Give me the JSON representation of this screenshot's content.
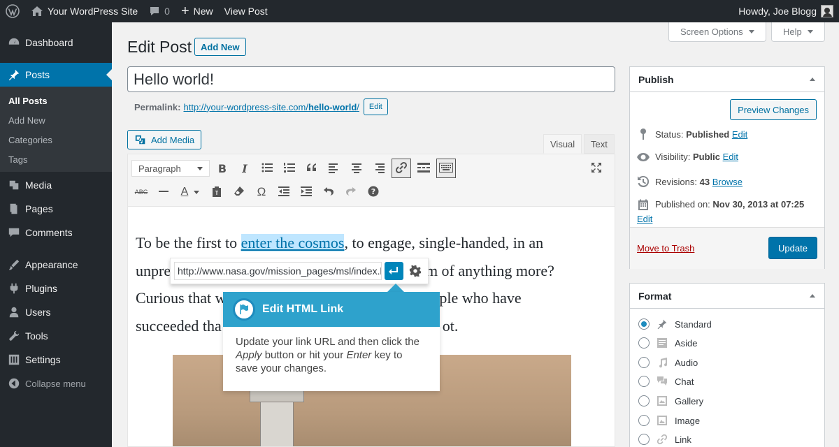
{
  "admin_bar": {
    "site_name": "Your WordPress Site",
    "comments_count": "0",
    "new_label": "New",
    "view_post": "View Post",
    "greeting": "Howdy, Joe Blogg"
  },
  "sidebar": {
    "items": [
      {
        "label": "Dashboard",
        "icon": "dashboard-icon"
      },
      {
        "label": "Posts",
        "icon": "pin-icon"
      },
      {
        "label": "Media",
        "icon": "media-icon"
      },
      {
        "label": "Pages",
        "icon": "pages-icon"
      },
      {
        "label": "Comments",
        "icon": "comments-icon"
      },
      {
        "label": "Appearance",
        "icon": "appearance-icon"
      },
      {
        "label": "Plugins",
        "icon": "plugins-icon"
      },
      {
        "label": "Users",
        "icon": "users-icon"
      },
      {
        "label": "Tools",
        "icon": "tools-icon"
      },
      {
        "label": "Settings",
        "icon": "settings-icon"
      },
      {
        "label": "Collapse menu",
        "icon": "collapse-icon"
      }
    ],
    "submenu": [
      "All Posts",
      "Add New",
      "Categories",
      "Tags"
    ]
  },
  "header": {
    "title": "Edit Post",
    "add_new": "Add New",
    "screen_options": "Screen Options",
    "help": "Help"
  },
  "post": {
    "title": "Hello world!",
    "permalink_label": "Permalink:",
    "permalink_base": "http://your-wordpress-site.com/",
    "permalink_slug": "hello-world",
    "permalink_trail": "/",
    "permalink_edit": "Edit"
  },
  "editor": {
    "add_media": "Add Media",
    "tab_visual": "Visual",
    "tab_text": "Text",
    "format_select": "Paragraph",
    "text_before": "To be the first to ",
    "link_text": "enter the cosmos",
    "text_line1_after": ", to engage, single-handed, in an",
    "line2_start": "unpre",
    "line2_end": "ream of anything more?",
    "line3_start": "Curious that w",
    "line3_end": "people who have",
    "line4_start": "succeeded tha",
    "line4_end": "ot."
  },
  "link_popup": {
    "url": "http://www.nasa.gov/mission_pages/msl/index.html"
  },
  "pointer": {
    "title": "Edit HTML Link",
    "body_1": "Update your link URL and then click the ",
    "body_apply": "Apply",
    "body_2": " button or hit your ",
    "body_enter": "Enter",
    "body_3": " key to save your changes."
  },
  "publish": {
    "title": "Publish",
    "preview": "Preview Changes",
    "status_label": "Status:",
    "status_value": "Published",
    "visibility_label": "Visibility:",
    "visibility_value": "Public",
    "revisions_label": "Revisions:",
    "revisions_value": "43",
    "browse": "Browse",
    "published_label": "Published on:",
    "published_value": "Nov 30, 2013 at 07:25",
    "edit": "Edit",
    "trash": "Move to Trash",
    "update": "Update"
  },
  "format": {
    "title": "Format",
    "options": [
      "Standard",
      "Aside",
      "Audio",
      "Chat",
      "Gallery",
      "Image",
      "Link"
    ],
    "selected": "Standard"
  },
  "colors": {
    "accent": "#0073aa",
    "pointer": "#2ea2cc",
    "admin_bg": "#23282d"
  }
}
